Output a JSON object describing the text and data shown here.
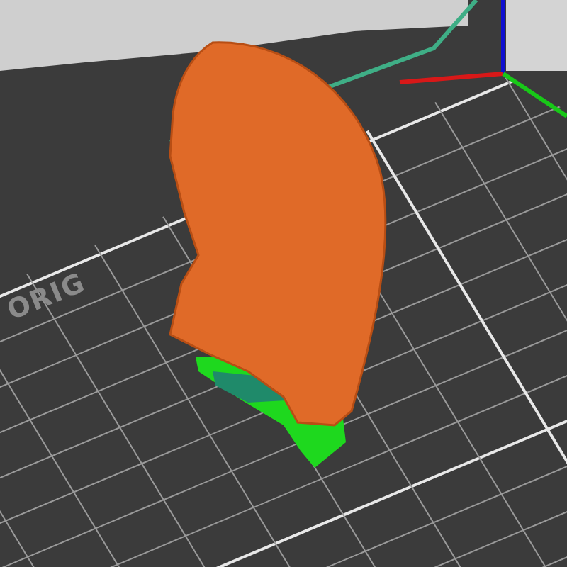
{
  "viewport": {
    "bed_label": "ORIG"
  }
}
